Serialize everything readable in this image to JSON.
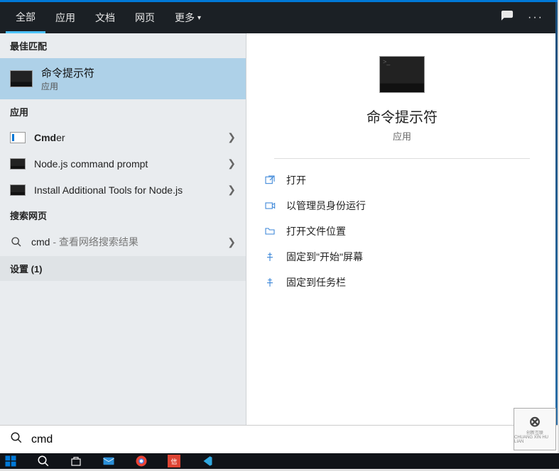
{
  "tabs": {
    "all": "全部",
    "apps": "应用",
    "docs": "文档",
    "web": "网页",
    "more": "更多"
  },
  "sections": {
    "best_match": "最佳匹配",
    "apps": "应用",
    "search_web": "搜索网页",
    "settings": "设置 (1)"
  },
  "best_match": {
    "title": "命令提示符",
    "subtitle": "应用"
  },
  "app_results": {
    "cmder_prefix": "Cmd",
    "cmder_suffix": "er",
    "node_prompt": "Node.js command prompt",
    "install_tools": "Install Additional Tools for Node.js"
  },
  "web_search": {
    "query": "cmd",
    "hint": " - 查看网络搜索结果"
  },
  "preview": {
    "title": "命令提示符",
    "subtitle": "应用"
  },
  "actions": {
    "open": "打开",
    "run_admin": "以管理员身份运行",
    "open_location": "打开文件位置",
    "pin_start": "固定到\"开始\"屏幕",
    "pin_taskbar": "固定到任务栏"
  },
  "search_input": {
    "value": "cmd"
  },
  "watermark": {
    "top": "创新互联",
    "bottom": "CHUANG XIN HU LIAN"
  }
}
